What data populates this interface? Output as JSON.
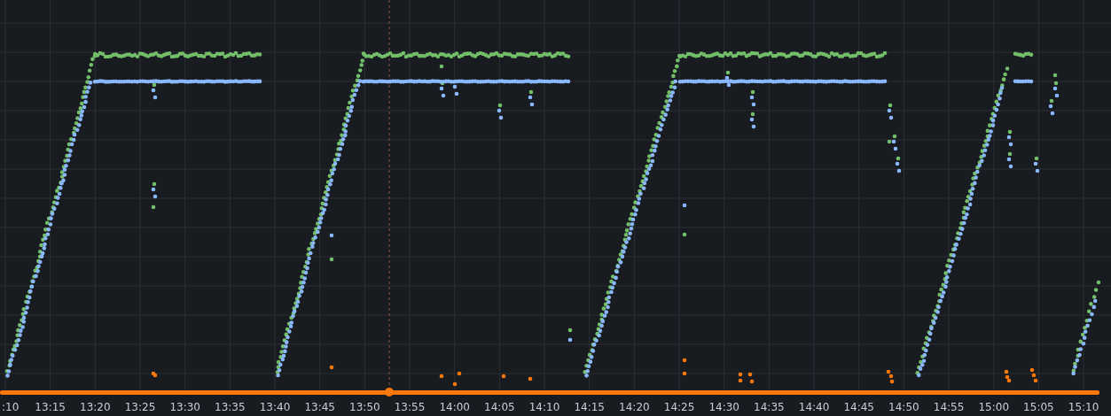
{
  "time_axis": {
    "ticks": [
      ":10",
      "13:15",
      "13:20",
      "13:25",
      "13:30",
      "13:35",
      "13:40",
      "13:45",
      "13:50",
      "13:55",
      "14:00",
      "14:05",
      "14:10",
      "14:15",
      "14:20",
      "14:25",
      "14:30",
      "14:35",
      "14:40",
      "14:45",
      "14:50",
      "14:55",
      "15:00",
      "15:05",
      "15:10"
    ]
  }
}
